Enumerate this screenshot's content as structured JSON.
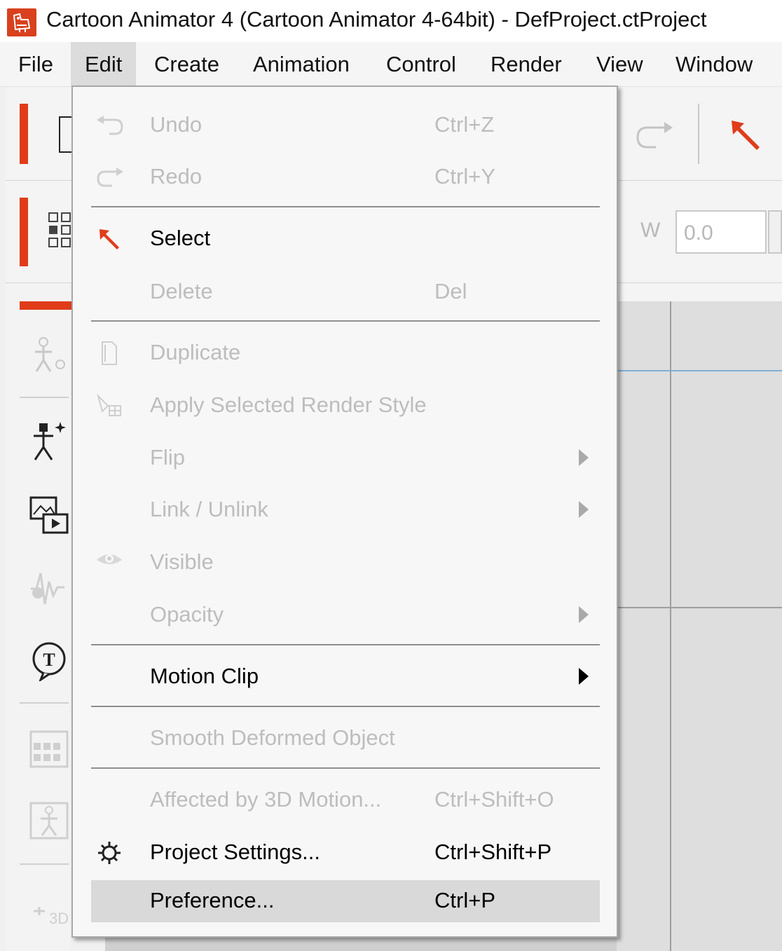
{
  "window": {
    "title": "Cartoon Animator 4  (Cartoon Animator 4-64bit) - DefProject.ctProject",
    "icon": "app-logo-icon"
  },
  "menubar": {
    "items": [
      {
        "label": "File"
      },
      {
        "label": "Edit"
      },
      {
        "label": "Create"
      },
      {
        "label": "Animation"
      },
      {
        "label": "Control"
      },
      {
        "label": "Render"
      },
      {
        "label": "View"
      },
      {
        "label": "Window"
      }
    ],
    "active": "Edit"
  },
  "toolbar": {
    "width_label": "W",
    "width_value": "0.0"
  },
  "edit_menu": {
    "items": [
      {
        "label": "Undo",
        "shortcut": "Ctrl+Z",
        "enabled": false,
        "icon": "undo-icon"
      },
      {
        "label": "Redo",
        "shortcut": "Ctrl+Y",
        "enabled": false,
        "icon": "redo-icon"
      },
      {
        "label": "Select",
        "shortcut": "",
        "enabled": true,
        "icon": "select-arrow-icon"
      },
      {
        "label": "Delete",
        "shortcut": "Del",
        "enabled": false,
        "icon": ""
      },
      {
        "label": "Duplicate",
        "shortcut": "",
        "enabled": false,
        "icon": "duplicate-icon"
      },
      {
        "label": "Apply Selected Render Style",
        "shortcut": "",
        "enabled": false,
        "icon": "render-style-icon"
      },
      {
        "label": "Flip",
        "shortcut": "",
        "enabled": false,
        "submenu": true
      },
      {
        "label": "Link / Unlink",
        "shortcut": "",
        "enabled": false,
        "submenu": true
      },
      {
        "label": "Visible",
        "shortcut": "",
        "enabled": false,
        "icon": "eye-icon"
      },
      {
        "label": "Opacity",
        "shortcut": "",
        "enabled": false,
        "submenu": true
      },
      {
        "label": "Motion Clip",
        "shortcut": "",
        "enabled": true,
        "submenu": true
      },
      {
        "label": "Smooth Deformed Object",
        "shortcut": "",
        "enabled": false
      },
      {
        "label": "Affected by 3D Motion...",
        "shortcut": "Ctrl+Shift+O",
        "enabled": false
      },
      {
        "label": "Project Settings...",
        "shortcut": "Ctrl+Shift+P",
        "enabled": true,
        "icon": "gear-icon"
      },
      {
        "label": "Preference...",
        "shortcut": "Ctrl+P",
        "enabled": true,
        "highlighted": true
      }
    ]
  },
  "colors": {
    "accent": "#e03c1a",
    "disabled_text": "#bdbdbd",
    "highlight": "#d9d9d9"
  }
}
